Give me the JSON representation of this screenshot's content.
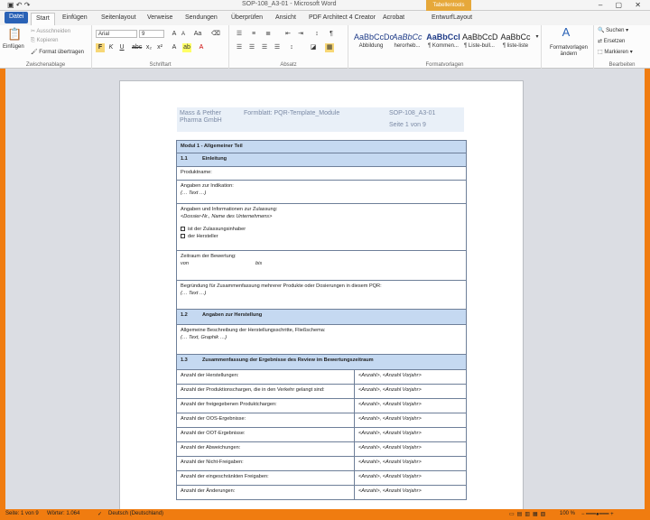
{
  "titlebar": {
    "title": "SOP-108_A3-01 - Microsoft Word",
    "context_tab": "Tabellentools",
    "controls": "– ▢ ✕"
  },
  "tabs": [
    "Datei",
    "Start",
    "Einfügen",
    "Seitenlayout",
    "Verweise",
    "Sendungen",
    "Überprüfen",
    "Ansicht",
    "PDF Architect 4 Creator",
    "Acrobat",
    "Entwurf",
    "Layout"
  ],
  "ribbon": {
    "clipboard": {
      "paste": "Einfügen",
      "cut": "Ausschneiden",
      "copy": "Kopieren",
      "format_painter": "Format übertragen",
      "label": "Zwischenablage"
    },
    "font": {
      "name": "Arial",
      "size": "9",
      "label": "Schriftart"
    },
    "paragraph": {
      "label": "Absatz"
    },
    "styles": {
      "items": [
        {
          "preview": "AaBbCcDc",
          "name": "Abbildung"
        },
        {
          "preview": "AaBbCc",
          "name": "herorheb..."
        },
        {
          "preview": "AaBbCcI",
          "name": "¶ Kommen..."
        },
        {
          "preview": "AaBbCcD",
          "name": "¶ Liste-bull..."
        },
        {
          "preview": "AaBbCc",
          "name": "¶ liste-liste"
        }
      ],
      "change": "Formatvorlagen ändern",
      "label": "Formatvorlagen"
    },
    "editing": {
      "find": "Suchen",
      "replace": "Ersetzen",
      "select": "Markieren",
      "label": "Bearbeiten"
    }
  },
  "doc_header": {
    "company": "Mass & Pether Pharma GmbH",
    "form": "Formblatt: PQR-Template_Module",
    "sop": "SOP-108_A3-01",
    "page": "Seite 1 von 9"
  },
  "module": {
    "title": "Modul 1 - Allgemeiner Teil",
    "s11": {
      "num": "1.1",
      "title": "Einleitung"
    },
    "product": "Produktname:",
    "indication": "Angaben zur Indikation:",
    "text_placeholder": "(… Text …)",
    "approval": "Angaben und Informationen zur Zulassung:",
    "approval_placeholder": "<Dossier-Nr., Name des Unternehmens>",
    "holder": "ist der Zulassungsinhaber",
    "manufacturer": "der Hersteller",
    "period": "Zeitraum der Bewertung:",
    "from": "von",
    "to": "bis",
    "reasoning": "Begründung für Zusammenfassung mehrerer Produkte oder Dosierungen in diesem PQR:",
    "s12": {
      "num": "1.2",
      "title": "Angaben zur Herstellung"
    },
    "process": "Allgemeine Beschreibung der Herstellungsschritte, Fließschema:",
    "process_placeholder": "(… Text, Graphik …)",
    "s13": {
      "num": "1.3",
      "title": "Zusammenfassung der Ergebnisse des Review im Bewertungszeitraum"
    },
    "rows": [
      {
        "label": "Anzahl der Herstellungen:",
        "value": "<Anzahl>, <Anzahl Vorjahr>"
      },
      {
        "label": "Anzahl der Produktionschargen, die in den Verkehr gelangt sind:",
        "value": "<Anzahl>, <Anzahl Vorjahr>"
      },
      {
        "label": "Anzahl der freigegebenen Produktchargen:",
        "value": "<Anzahl>, <Anzahl Vorjahr>"
      },
      {
        "label": "Anzahl der OOS-Ergebnisse:",
        "value": "<Anzahl>, <Anzahl Vorjahr>"
      },
      {
        "label": "Anzahl der OOT-Ergebnisse:",
        "value": "<Anzahl>, <Anzahl Vorjahr>"
      },
      {
        "label": "Anzahl der Abweichungen:",
        "value": "<Anzahl>, <Anzahl Vorjahr>"
      },
      {
        "label": "Anzahl der Nicht-Freigaben:",
        "value": "<Anzahl>, <Anzahl Vorjahr>"
      },
      {
        "label": "Anzahl der eingeschränkten Freigaben:",
        "value": "<Anzahl>, <Anzahl Vorjahr>"
      },
      {
        "label": "Anzahl der Änderungen:",
        "value": "<Anzahl>, <Anzahl Vorjahr>"
      }
    ]
  },
  "status": {
    "page": "Seite: 1 von 9",
    "words": "Wörter: 1.064",
    "language": "Deutsch (Deutschland)",
    "zoom": "100 %"
  }
}
